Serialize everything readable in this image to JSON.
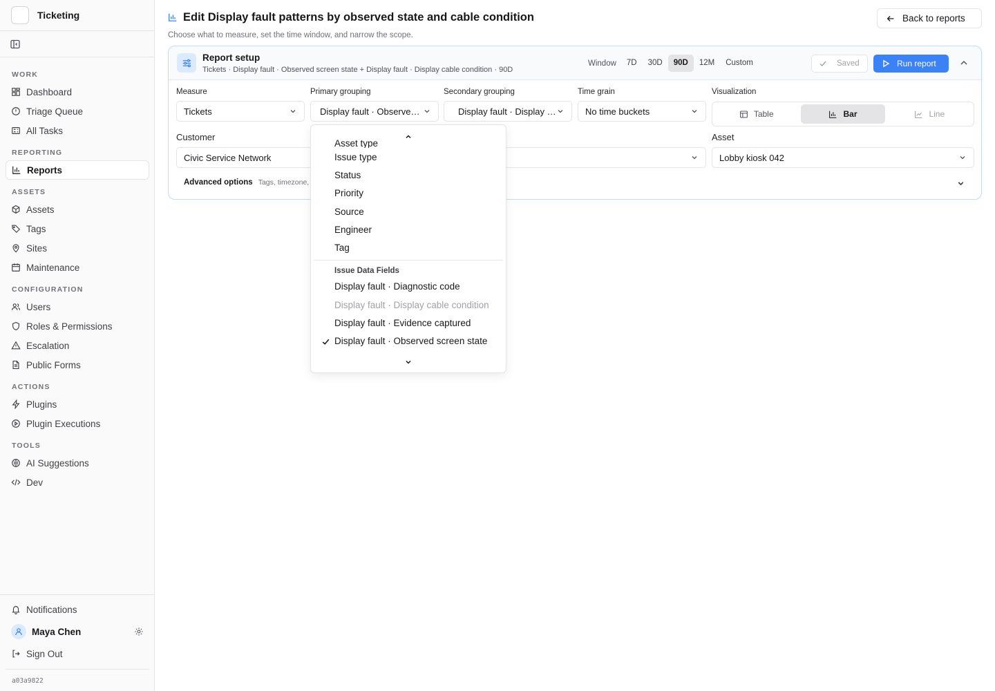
{
  "app": {
    "name": "Ticketing",
    "build_id": "a03a9822"
  },
  "sidebar": {
    "sections": [
      {
        "title": "WORK",
        "items": [
          {
            "label": "Dashboard",
            "icon": "dashboard-icon"
          },
          {
            "label": "Triage Queue",
            "icon": "alert-circle-icon"
          },
          {
            "label": "All Tasks",
            "icon": "tasks-icon"
          }
        ]
      },
      {
        "title": "REPORTING",
        "items": [
          {
            "label": "Reports",
            "icon": "bar-chart-icon",
            "active": true
          }
        ]
      },
      {
        "title": "ASSETS",
        "items": [
          {
            "label": "Assets",
            "icon": "box-icon"
          },
          {
            "label": "Tags",
            "icon": "tag-icon"
          },
          {
            "label": "Sites",
            "icon": "map-pin-icon"
          },
          {
            "label": "Maintenance",
            "icon": "calendar-icon"
          }
        ]
      },
      {
        "title": "CONFIGURATION",
        "items": [
          {
            "label": "Users",
            "icon": "users-icon"
          },
          {
            "label": "Roles & Permissions",
            "icon": "shield-icon"
          },
          {
            "label": "Escalation",
            "icon": "warning-icon"
          },
          {
            "label": "Public Forms",
            "icon": "file-icon"
          }
        ]
      },
      {
        "title": "ACTIONS",
        "items": [
          {
            "label": "Plugins",
            "icon": "bolt-icon"
          },
          {
            "label": "Plugin Executions",
            "icon": "play-circle-icon"
          }
        ]
      },
      {
        "title": "TOOLS",
        "items": [
          {
            "label": "AI Suggestions",
            "icon": "ai-icon"
          },
          {
            "label": "Dev",
            "icon": "code-icon"
          }
        ]
      }
    ],
    "notifications_label": "Notifications",
    "user_name": "Maya Chen",
    "sign_out_label": "Sign Out"
  },
  "header": {
    "title": "Edit Display fault patterns by observed state and cable condition",
    "subtitle": "Choose what to measure, set the time window, and narrow the scope.",
    "back_label": "Back to reports"
  },
  "setup": {
    "title": "Report setup",
    "summary": "Tickets · Display fault · Observed screen state + Display fault · Display cable condition · 90D",
    "window_label": "Window",
    "windows": [
      {
        "label": "7D",
        "active": false
      },
      {
        "label": "30D",
        "active": false
      },
      {
        "label": "90D",
        "active": true
      },
      {
        "label": "12M",
        "active": false
      },
      {
        "label": "Custom",
        "active": false
      }
    ],
    "saved_label": "Saved",
    "run_label": "Run report",
    "measure": {
      "label": "Measure",
      "value": "Tickets"
    },
    "primary": {
      "label": "Primary grouping",
      "value": "Display fault · Observed screen state"
    },
    "secondary": {
      "label": "Secondary grouping",
      "value": "Display fault · Display cable condition"
    },
    "time_grain": {
      "label": "Time grain",
      "value": "No time buckets"
    },
    "visualization": {
      "label": "Visualization",
      "options": [
        {
          "label": "Table",
          "icon": "table-icon",
          "state": "normal"
        },
        {
          "label": "Bar",
          "icon": "bar-chart-icon",
          "state": "active"
        },
        {
          "label": "Line",
          "icon": "line-chart-icon",
          "state": "disabled"
        }
      ]
    },
    "customer": {
      "label": "Customer",
      "value": "Civic Service Network"
    },
    "asset": {
      "label": "Asset",
      "value": "Lobby kiosk 042"
    },
    "advanced": {
      "title": "Advanced options",
      "subtitle": "Tags, timezone, an"
    }
  },
  "dropdown": {
    "partial_item": "Asset type",
    "items": [
      "Issue type",
      "Status",
      "Priority",
      "Source",
      "Engineer",
      "Tag"
    ],
    "group_title": "Issue Data Fields",
    "group_items": [
      {
        "label": "Display fault · Diagnostic code",
        "state": "normal"
      },
      {
        "label": "Display fault · Display cable condition",
        "state": "disabled"
      },
      {
        "label": "Display fault · Evidence captured",
        "state": "normal"
      },
      {
        "label": "Display fault · Observed screen state",
        "state": "selected"
      }
    ]
  }
}
